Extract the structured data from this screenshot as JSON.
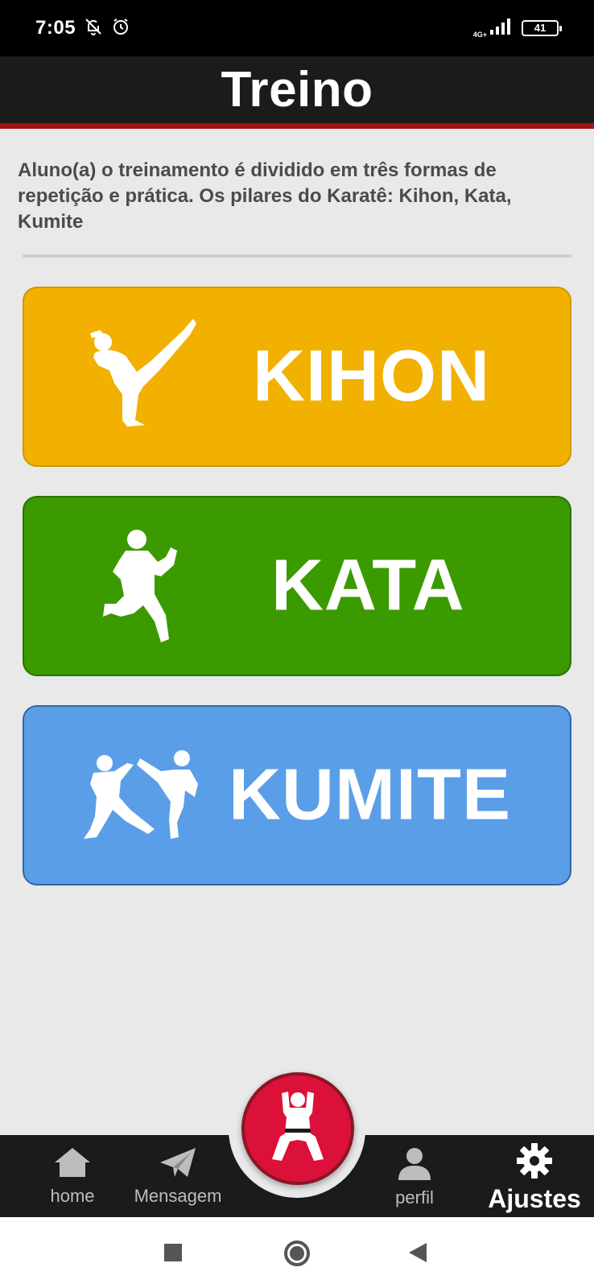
{
  "status_bar": {
    "time": "7:05",
    "network": "4G+",
    "battery": "41",
    "icons": [
      "bell-off-icon",
      "alarm-icon",
      "signal-icon",
      "battery-icon"
    ]
  },
  "header": {
    "title": "Treino",
    "accent_color": "#a31414"
  },
  "intro": {
    "text": "Aluno(a) o treinamento é dividido em três formas de repetição e prática. Os pilares do Karatê: Kihon, Kata, Kumite"
  },
  "cards": [
    {
      "label": "KIHON",
      "color": "#f2b100",
      "icon": "karate-high-kick-icon"
    },
    {
      "label": "KATA",
      "color": "#3a9a00",
      "icon": "karate-stance-icon"
    },
    {
      "label": "KUMITE",
      "color": "#5a9ee8",
      "icon": "karate-sparring-icon"
    }
  ],
  "bottom_nav": {
    "items": [
      {
        "label": "home",
        "icon": "home-icon"
      },
      {
        "label": "Mensagem",
        "icon": "paper-plane-icon"
      },
      {
        "label": "perfil",
        "icon": "user-icon"
      },
      {
        "label": "Ajustes",
        "icon": "gear-icon",
        "active": true
      }
    ],
    "center_button": {
      "icon": "karate-fighter-icon",
      "color": "#dc1139"
    }
  },
  "system_nav": [
    "recents-square-icon",
    "home-circle-icon",
    "back-triangle-icon"
  ]
}
